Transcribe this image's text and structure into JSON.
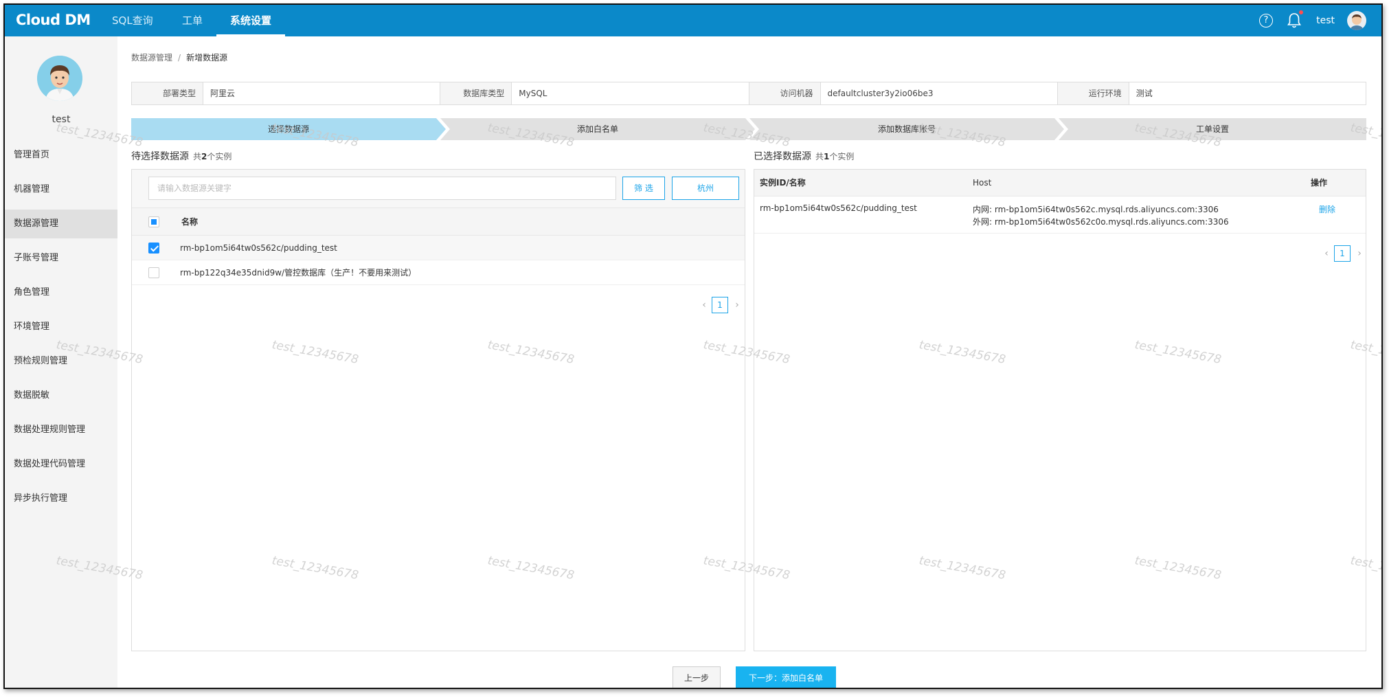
{
  "app": {
    "logo": "Cloud DM"
  },
  "topnav": {
    "items": [
      {
        "label": "SQL查询"
      },
      {
        "label": "工单"
      },
      {
        "label": "系统设置"
      }
    ],
    "help": "?",
    "user": "test"
  },
  "sidebar": {
    "user": "test",
    "items": [
      {
        "label": "管理首页"
      },
      {
        "label": "机器管理"
      },
      {
        "label": "数据源管理"
      },
      {
        "label": "子账号管理"
      },
      {
        "label": "角色管理"
      },
      {
        "label": "环境管理"
      },
      {
        "label": "预检规则管理"
      },
      {
        "label": "数据脱敏"
      },
      {
        "label": "数据处理规则管理"
      },
      {
        "label": "数据处理代码管理"
      },
      {
        "label": "异步执行管理"
      }
    ]
  },
  "breadcrumb": {
    "parent": "数据源管理",
    "separator": "/",
    "current": "新增数据源"
  },
  "info": [
    {
      "label": "部署类型",
      "value": "阿里云"
    },
    {
      "label": "数据库类型",
      "value": "MySQL"
    },
    {
      "label": "访问机器",
      "value": "defaultcluster3y2io06be3"
    },
    {
      "label": "运行环境",
      "value": "测试"
    }
  ],
  "steps": [
    {
      "label": "选择数据源"
    },
    {
      "label": "添加白名单"
    },
    {
      "label": "添加数据库账号"
    },
    {
      "label": "工单设置"
    }
  ],
  "left_panel": {
    "title": "待选择数据源",
    "count_prefix": "共",
    "count": "2",
    "count_suffix": "个实例",
    "search_placeholder": "请输入数据源关键字",
    "filter_button": "筛 选",
    "region_button": "杭州",
    "column_name": "名称",
    "rows": [
      {
        "name": "rm-bp1om5i64tw0s562c/pudding_test"
      },
      {
        "name": "rm-bp122q34e35dnid9w/管控数据库（生产！不要用来测试）"
      }
    ],
    "page": "1"
  },
  "right_panel": {
    "title": "已选择数据源",
    "count_prefix": "共",
    "count": "1",
    "count_suffix": "个实例",
    "columns": {
      "id": "实例ID/名称",
      "host": "Host",
      "action": "操作"
    },
    "rows": [
      {
        "id": "rm-bp1om5i64tw0s562c/pudding_test",
        "inner": "内网: rm-bp1om5i64tw0s562c.mysql.rds.aliyuncs.com:3306",
        "outer": "外网: rm-bp1om5i64tw0s562c0o.mysql.rds.aliyuncs.com:3306",
        "action": "删除"
      }
    ],
    "page": "1"
  },
  "footer": {
    "prev": "上一步",
    "next": "下一步：添加白名单"
  },
  "watermark": "test_12345678",
  "colors": {
    "header": "#0b89c9",
    "accent": "#1aa3e8",
    "primary_button": "#19b3f0",
    "step_active": "#a9dcf2"
  }
}
